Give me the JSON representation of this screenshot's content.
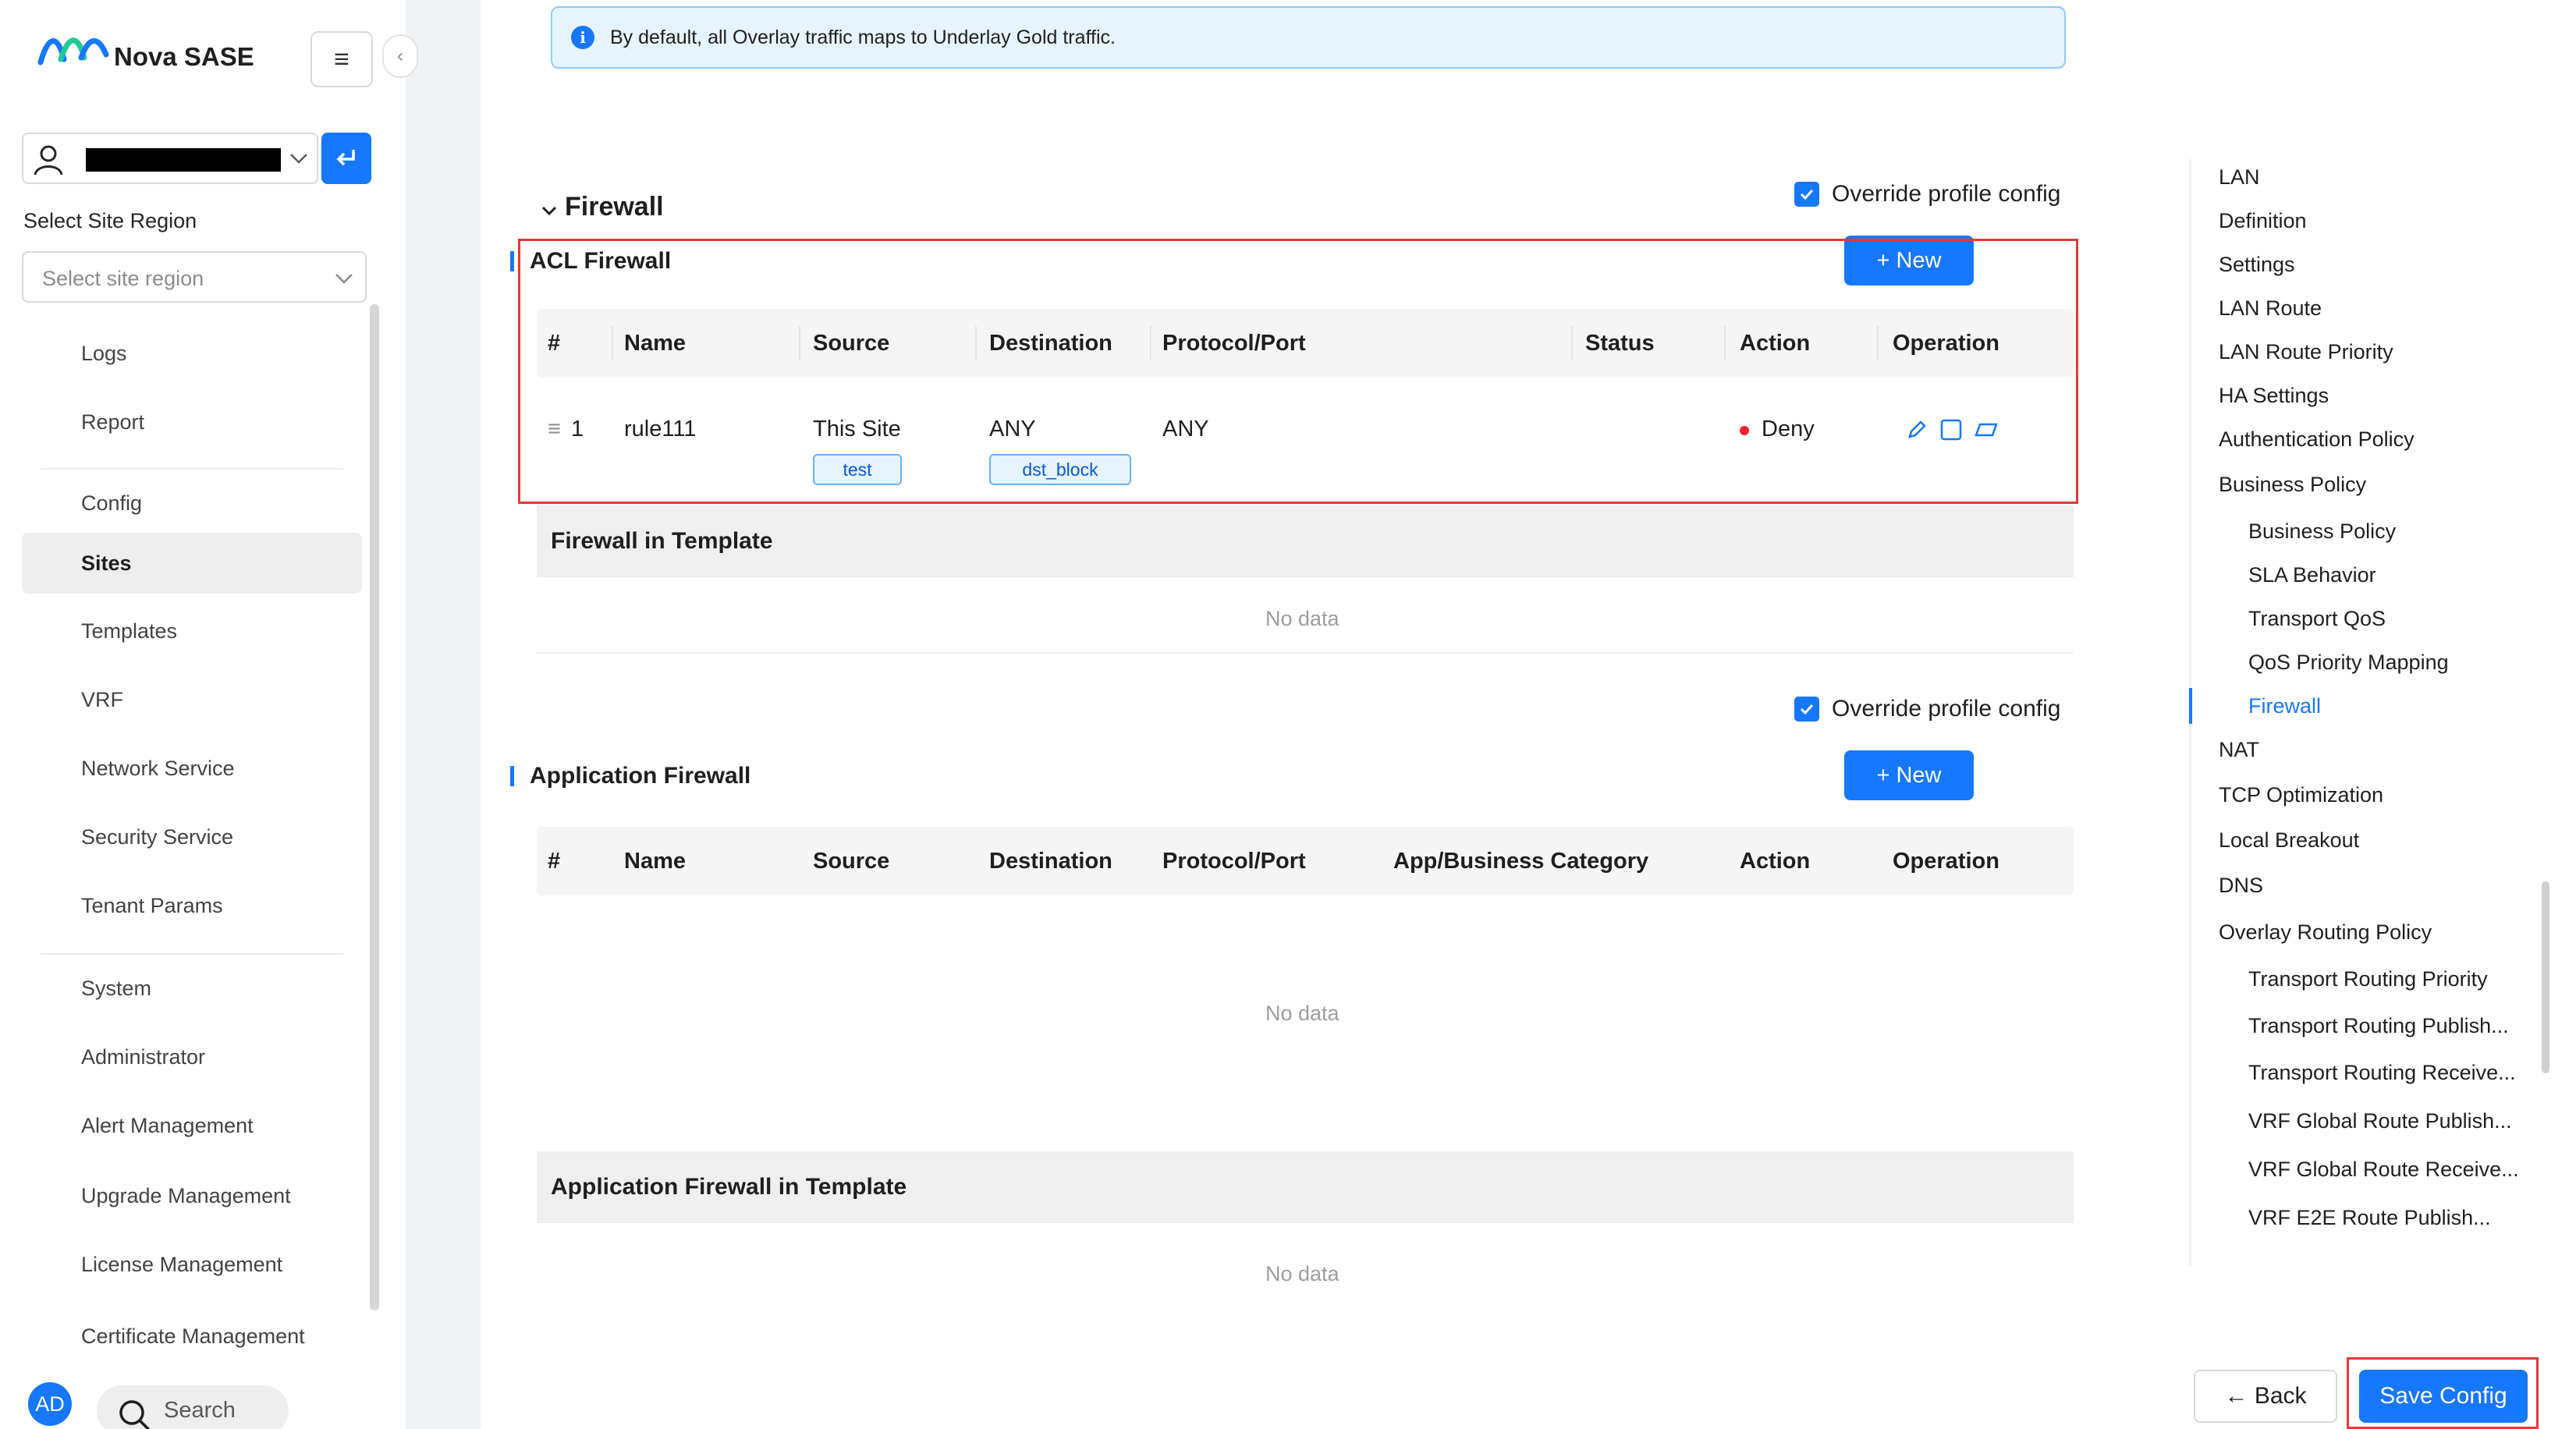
{
  "app": {
    "title": "Nova SASE"
  },
  "sidebar": {
    "region_label": "Select Site Region",
    "region_placeholder": "Select site region",
    "nav": [
      {
        "label": "Logs"
      },
      {
        "label": "Report"
      },
      {
        "label": "Config"
      },
      {
        "label": "Sites",
        "active": true
      },
      {
        "label": "Templates"
      },
      {
        "label": "VRF"
      },
      {
        "label": "Network Service"
      },
      {
        "label": "Security Service"
      },
      {
        "label": "Tenant Params"
      },
      {
        "label": "System"
      },
      {
        "label": "Administrator"
      },
      {
        "label": "Alert Management"
      },
      {
        "label": "Upgrade Management"
      },
      {
        "label": "License Management"
      },
      {
        "label": "Certificate Management"
      }
    ],
    "avatar": "AD",
    "search_label": "Search"
  },
  "main": {
    "info_banner": "By default, all Overlay traffic maps to Underlay Gold traffic.",
    "section_title": "Firewall",
    "override_label": "Override profile config",
    "acl": {
      "title": "ACL Firewall",
      "new_label": "+ New",
      "columns": [
        "#",
        "Name",
        "Source",
        "Destination",
        "Protocol/Port",
        "Status",
        "Action",
        "Operation"
      ],
      "rows": [
        {
          "index": "1",
          "name": "rule111",
          "source": "This Site",
          "source_tag": "test",
          "destination": "ANY",
          "destination_tag": "dst_block",
          "protocol_port": "ANY",
          "status": "",
          "action": "Deny"
        }
      ]
    },
    "acl_template": {
      "title": "Firewall in Template",
      "empty": "No data"
    },
    "override_label_2": "Override profile config",
    "app_fw": {
      "title": "Application Firewall",
      "new_label": "+ New",
      "columns": [
        "#",
        "Name",
        "Source",
        "Destination",
        "Protocol/Port",
        "App/Business Category",
        "Action",
        "Operation"
      ],
      "empty": "No data"
    },
    "app_template": {
      "title": "Application Firewall in Template",
      "empty": "No data"
    }
  },
  "anchor_nav": [
    {
      "label": "LAN",
      "level": 1
    },
    {
      "label": "Definition",
      "level": 1
    },
    {
      "label": "Settings",
      "level": 1
    },
    {
      "label": "LAN Route",
      "level": 1
    },
    {
      "label": "LAN Route Priority",
      "level": 1
    },
    {
      "label": "HA Settings",
      "level": 1
    },
    {
      "label": "Authentication Policy",
      "level": 1
    },
    {
      "label": "Business Policy",
      "level": 1
    },
    {
      "label": "Business Policy",
      "level": 2
    },
    {
      "label": "SLA Behavior",
      "level": 2
    },
    {
      "label": "Transport QoS",
      "level": 2
    },
    {
      "label": "QoS Priority Mapping",
      "level": 2
    },
    {
      "label": "Firewall",
      "level": 2,
      "active": true
    },
    {
      "label": "NAT",
      "level": 1
    },
    {
      "label": "TCP Optimization",
      "level": 1
    },
    {
      "label": "Local Breakout",
      "level": 1
    },
    {
      "label": "DNS",
      "level": 1
    },
    {
      "label": "Overlay Routing Policy",
      "level": 1
    },
    {
      "label": "Transport Routing Priority",
      "level": 2
    },
    {
      "label": "Transport Routing Publish...",
      "level": 2
    },
    {
      "label": "Transport Routing Receive...",
      "level": 2
    },
    {
      "label": "VRF Global Route Publish...",
      "level": 2
    },
    {
      "label": "VRF Global Route Receive...",
      "level": 2
    },
    {
      "label": "VRF E2E Route Publish...",
      "level": 2
    }
  ],
  "footer": {
    "back_label": "← Back",
    "save_label": "Save Config"
  },
  "colors": {
    "primary": "#1677ff",
    "deny": "#f5222d",
    "highlight": "#e53935"
  }
}
